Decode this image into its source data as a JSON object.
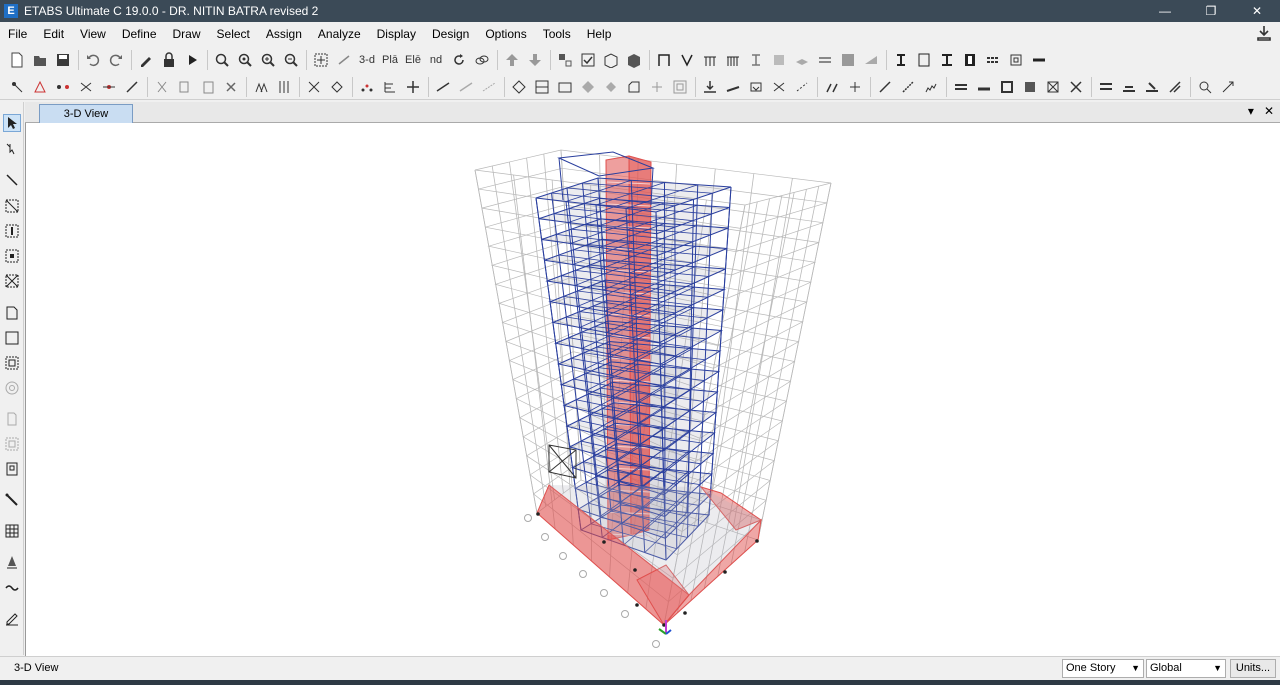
{
  "window": {
    "title": "ETABS Ultimate C 19.0.0 - DR. NITIN BATRA revised 2",
    "app_icon_letter": "E",
    "minimize": "—",
    "restore": "❐",
    "close": "✕"
  },
  "menu": [
    "File",
    "Edit",
    "View",
    "Define",
    "Draw",
    "Select",
    "Assign",
    "Analyze",
    "Display",
    "Design",
    "Options",
    "Tools",
    "Help"
  ],
  "toolbar": {
    "view_3d_label": "3-d",
    "plan_label": "Plā",
    "elev_label": "Elē",
    "nd_label": "nd"
  },
  "tab": {
    "label": "3-D View",
    "dropdown_glyph": "▾",
    "close_glyph": "✕"
  },
  "status": {
    "text": "3-D View",
    "story_option": "One Story",
    "coord_option": "Global",
    "units_label": "Units..."
  },
  "colors": {
    "titlebar": "#3b4a57",
    "frame_blue": "#2a3f9e",
    "wall_red": "#e0504e",
    "grid_gray": "#b9b9b9"
  }
}
